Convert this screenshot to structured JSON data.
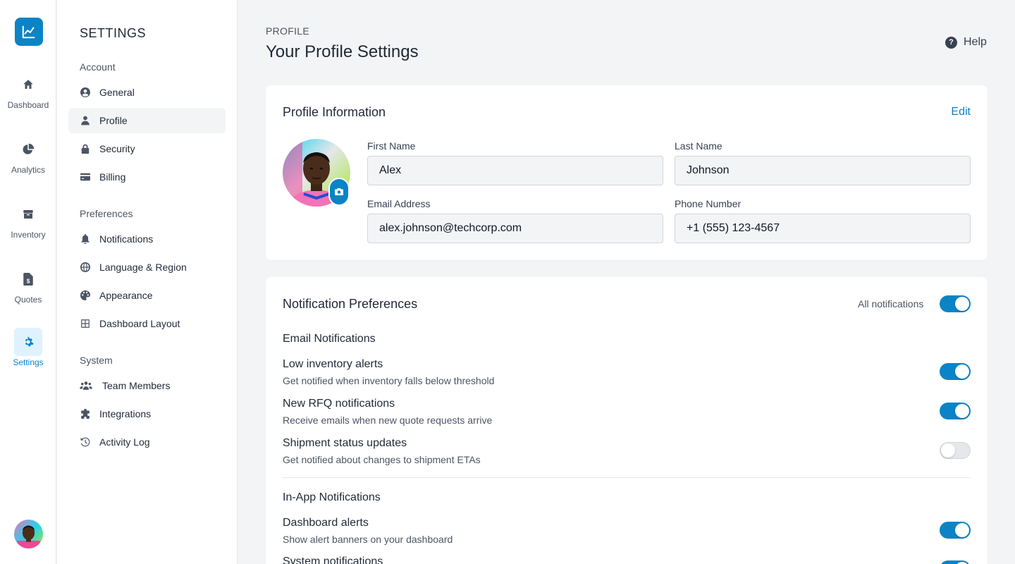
{
  "rail": {
    "logo_icon": "chart-line-icon",
    "items": [
      {
        "label": "Dashboard",
        "icon": "home-icon"
      },
      {
        "label": "Analytics",
        "icon": "pie-chart-icon"
      },
      {
        "label": "Inventory",
        "icon": "box-icon"
      },
      {
        "label": "Quotes",
        "icon": "invoice-dollar-icon"
      },
      {
        "label": "Settings",
        "icon": "gear-icon",
        "active": true
      }
    ]
  },
  "settings_nav": {
    "title": "SETTINGS",
    "groups": [
      {
        "label": "Account",
        "items": [
          {
            "label": "General",
            "icon": "user-circle-icon"
          },
          {
            "label": "Profile",
            "icon": "user-icon",
            "active": true
          },
          {
            "label": "Security",
            "icon": "lock-icon"
          },
          {
            "label": "Billing",
            "icon": "credit-card-icon"
          }
        ]
      },
      {
        "label": "Preferences",
        "items": [
          {
            "label": "Notifications",
            "icon": "bell-icon"
          },
          {
            "label": "Language & Region",
            "icon": "globe-icon"
          },
          {
            "label": "Appearance",
            "icon": "palette-icon"
          },
          {
            "label": "Dashboard Layout",
            "icon": "grid-icon"
          }
        ]
      },
      {
        "label": "System",
        "items": [
          {
            "label": "Team Members",
            "icon": "users-icon"
          },
          {
            "label": "Integrations",
            "icon": "puzzle-icon"
          },
          {
            "label": "Activity Log",
            "icon": "history-icon"
          }
        ]
      }
    ]
  },
  "header": {
    "breadcrumb": "PROFILE",
    "title": "Your Profile Settings",
    "help_label": "Help"
  },
  "profile": {
    "title": "Profile Information",
    "edit_label": "Edit",
    "fields": {
      "first_name": {
        "label": "First Name",
        "value": "Alex"
      },
      "last_name": {
        "label": "Last Name",
        "value": "Johnson"
      },
      "email": {
        "label": "Email Address",
        "value": "alex.johnson@techcorp.com"
      },
      "phone": {
        "label": "Phone Number",
        "value": "+1 (555) 123-4567"
      }
    }
  },
  "notifications": {
    "title": "Notification Preferences",
    "all_label": "All notifications",
    "all_on": true,
    "email_section": "Email Notifications",
    "email_items": [
      {
        "title": "Low inventory alerts",
        "desc": "Get notified when inventory falls below threshold",
        "on": true
      },
      {
        "title": "New RFQ notifications",
        "desc": "Receive emails when new quote requests arrive",
        "on": true
      },
      {
        "title": "Shipment status updates",
        "desc": "Get notified about changes to shipment ETAs",
        "on": false
      }
    ],
    "inapp_section": "In-App Notifications",
    "inapp_items": [
      {
        "title": "Dashboard alerts",
        "desc": "Show alert banners on your dashboard",
        "on": true
      },
      {
        "title": "System notifications",
        "desc": "",
        "on": true
      }
    ]
  },
  "colors": {
    "accent": "#0a84c6",
    "bg": "#f3f4f6"
  }
}
